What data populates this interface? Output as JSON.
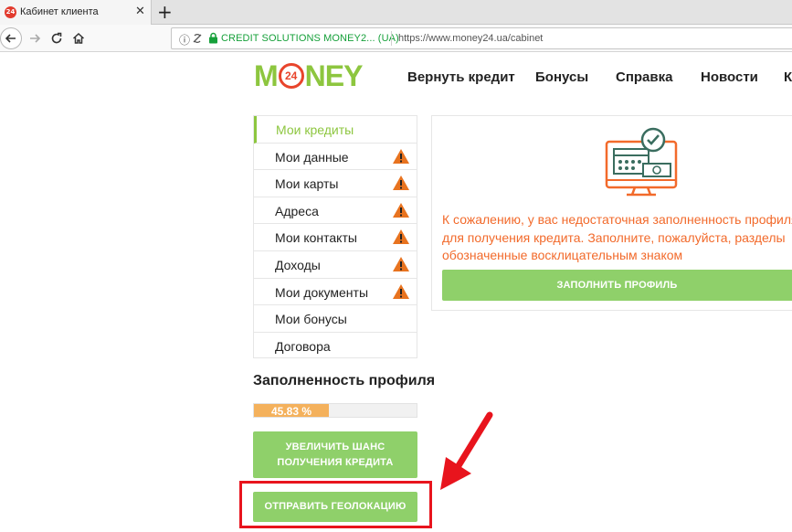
{
  "browser": {
    "tab_title": "Кабинет клиента",
    "url_org": "CREDIT SOLUTIONS MONEY2...  (UA)",
    "url_text": "https://www.money24.ua/cabinet"
  },
  "site": {
    "logo": {
      "left": "M",
      "badge": "24",
      "right": "NEY"
    },
    "nav": [
      "Вернуть кредит",
      "Бонусы",
      "Справка",
      "Новости",
      "К"
    ]
  },
  "menu": {
    "items": [
      {
        "label": "Мои кредиты",
        "active": true,
        "warning": false
      },
      {
        "label": "Мои данные",
        "active": false,
        "warning": true
      },
      {
        "label": "Мои карты",
        "active": false,
        "warning": true
      },
      {
        "label": "Адреса",
        "active": false,
        "warning": true
      },
      {
        "label": "Мои контакты",
        "active": false,
        "warning": true
      },
      {
        "label": "Доходы",
        "active": false,
        "warning": true
      },
      {
        "label": "Мои документы",
        "active": false,
        "warning": true
      },
      {
        "label": "Мои бонусы",
        "active": false,
        "warning": false
      },
      {
        "label": "Договора",
        "active": false,
        "warning": false
      }
    ]
  },
  "profile": {
    "title": "Заполненность профиля",
    "progress_text": "45.83 %",
    "progress_value": 45.83,
    "chance_button": "УВЕЛИЧИТЬ ШАНС ПОЛУЧЕНИЯ КРЕДИТА",
    "geo_button": "ОТПРАВИТЬ ГЕОЛОКАЦИЮ"
  },
  "panel": {
    "message_lines": [
      "К сожалению, у вас недостаточная заполненность профиля",
      "для получения кредита. Заполните, пожалуйста, разделы",
      "обозначенные восклицательным знаком"
    ],
    "fill_button": "ЗАПОЛНИТЬ ПРОФИЛЬ"
  },
  "colors": {
    "brand_green": "#8dc63f",
    "button_green": "#8fd06a",
    "warning_orange": "#e8731f",
    "message_orange": "#f26a2b",
    "progress_orange": "#f4b15c",
    "highlight_red": "#e8141d"
  }
}
